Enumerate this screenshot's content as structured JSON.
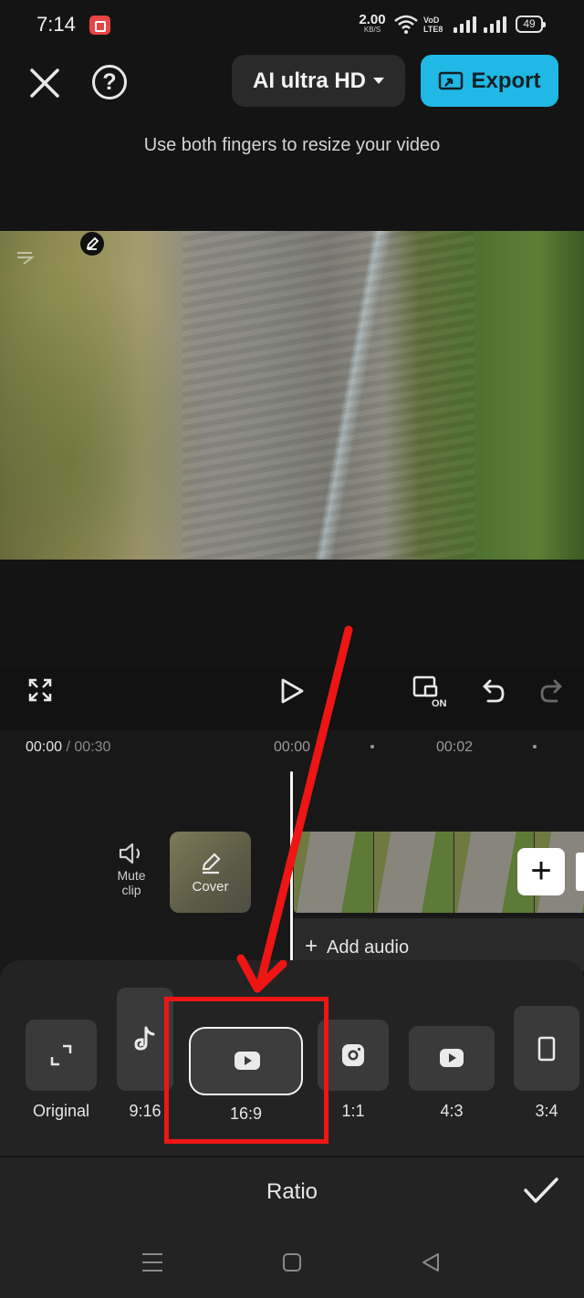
{
  "status_bar": {
    "time": "7:14",
    "net_speed_value": "2.00",
    "net_speed_unit": "KB/S",
    "volte_label_top": "VoD",
    "volte_label_bottom": "LTE8",
    "battery": "49"
  },
  "top_bar": {
    "quality_label": "AI ultra HD",
    "export_label": "Export",
    "help_glyph": "?",
    "hint": "Use both fingers to resize your video"
  },
  "timeline": {
    "current_time": "00:00",
    "total_time": "/ 00:30",
    "tick_0": "00:00",
    "tick_2": "00:02",
    "mute_label_1": "Mute",
    "mute_label_2": "clip",
    "cover_label": "Cover",
    "add_clip_glyph": "+",
    "add_audio_glyph": "+",
    "add_audio_label": "Add audio"
  },
  "ratio_panel": {
    "title": "Ratio",
    "options": [
      {
        "label": "Original",
        "icon": "expand-corners-icon"
      },
      {
        "label": "9:16",
        "icon": "tiktok-icon"
      },
      {
        "label": "16:9",
        "icon": "youtube-icon",
        "selected": true
      },
      {
        "label": "1:1",
        "icon": "instagram-icon"
      },
      {
        "label": "4:3",
        "icon": "youtube-icon"
      },
      {
        "label": "3:4",
        "icon": "portrait-frame-icon"
      }
    ]
  },
  "colors": {
    "accent": "#20b8e4",
    "annotation_red": "#ee1515",
    "background": "#141414",
    "panel": "#232323"
  }
}
